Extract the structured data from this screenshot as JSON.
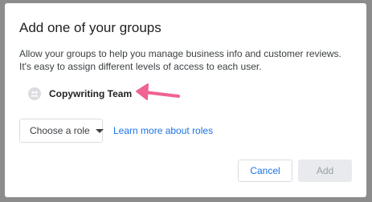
{
  "dialog": {
    "title": "Add one of your groups",
    "description": "Allow your groups to help you manage business info and customer reviews. It's easy to assign different levels of access to each user."
  },
  "group_selector": {
    "selected_group": "Copywriting Team",
    "avatar_icon": "group-icon",
    "dropdown_icon": "caret-down-icon"
  },
  "annotation": {
    "arrow_color": "#f06292"
  },
  "role": {
    "select_label": "Choose a role",
    "learn_more_link": "Learn more about roles"
  },
  "actions": {
    "cancel_label": "Cancel",
    "add_label": "Add"
  },
  "colors": {
    "accent": "#1a73e8",
    "overlay": "#8c8c8c",
    "disabled_bg": "#e8eaed",
    "disabled_text": "#9aa0a6"
  }
}
